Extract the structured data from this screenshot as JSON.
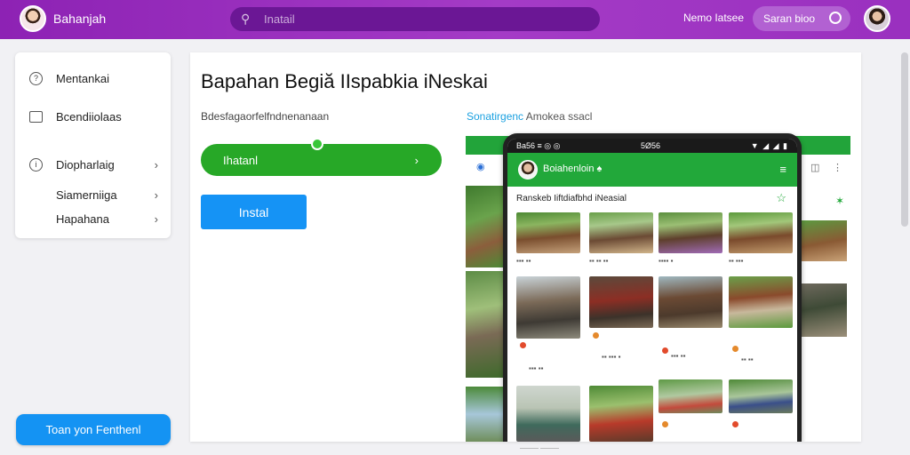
{
  "topbar": {
    "brand_name": "Bahanjah",
    "search_placeholder": "Inatail",
    "link": "Nemo Iatsee",
    "pill_label": "Saran bioo"
  },
  "sidemenu": {
    "items": [
      {
        "label": "Mentankai",
        "icon": "help-circle-icon",
        "chevron": false
      },
      {
        "label": "Bcendiiolaas",
        "icon": "list-icon",
        "chevron": false
      },
      {
        "label": "Diopharlaig",
        "icon": "info-circle-icon",
        "chevron": true
      },
      {
        "label": "Siamerniiga",
        "icon": "",
        "chevron": true
      },
      {
        "label": "Hapahana",
        "icon": "",
        "chevron": true
      }
    ]
  },
  "cta_label": "Toan yon Fenthenl",
  "main": {
    "title": "Bapahan Begiă IIspabkia iNeskai",
    "subtitle": "Bdesfagaorfelfndnenanaan",
    "green_bar_label": "Ihatanl",
    "install_label": "Instal",
    "preview_caption_highlight": "Sonatirgenc",
    "preview_caption_rest": "Amokea ssacl"
  },
  "phone": {
    "status_left": "Ba56 ≡ ◎ ◎",
    "status_center": "5Ø56",
    "status_right": "▼ ◢ ◢ ▮",
    "app_title": "Boiahenloin ♠",
    "section_title": "Ranskeb Iiftdiafbhd iNeasial"
  },
  "bottom_note": "——— ———",
  "colors": {
    "topbar": "#9a30bf",
    "green": "#27a827",
    "blue": "#1593f5"
  }
}
